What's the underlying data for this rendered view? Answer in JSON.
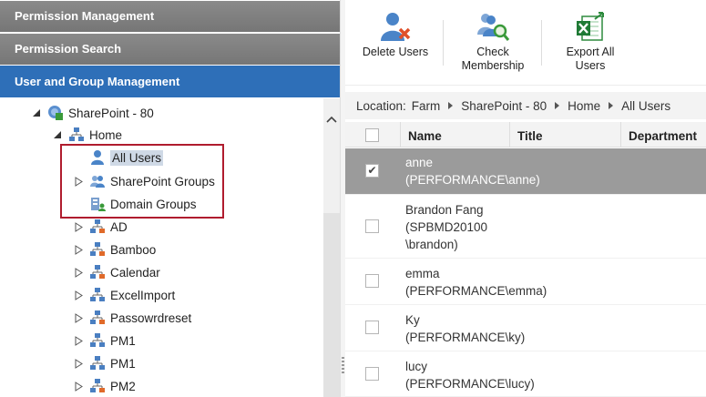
{
  "accordion": {
    "permission_management": "Permission Management",
    "permission_search": "Permission Search",
    "user_group_management": "User and Group Management"
  },
  "tree": {
    "root": "SharePoint - 80",
    "home": "Home",
    "all_users": "All Users",
    "sharepoint_groups": "SharePoint Groups",
    "domain_groups": "Domain Groups",
    "sites": [
      "AD",
      "Bamboo",
      "Calendar",
      "ExcelImport",
      "Passowrdreset",
      "PM1",
      "PM1",
      "PM2"
    ]
  },
  "ribbon": {
    "delete_users": "Delete Users",
    "check_membership_1": "Check",
    "check_membership_2": "Membership",
    "export_all_1": "Export All",
    "export_all_2": "Users"
  },
  "location": {
    "label": "Location:",
    "crumbs": [
      "Farm",
      "SharePoint - 80",
      "Home",
      "All Users"
    ]
  },
  "grid": {
    "columns": [
      "Name",
      "Title",
      "Department"
    ],
    "rows": [
      {
        "lines": [
          "anne",
          "(PERFORMANCE\\anne)"
        ],
        "checked": true
      },
      {
        "lines": [
          "Brandon Fang",
          "(SPBMD20100",
          "\\brandon)"
        ],
        "checked": false
      },
      {
        "lines": [
          "emma",
          "(PERFORMANCE\\emma)"
        ],
        "checked": false
      },
      {
        "lines": [
          "Ky",
          "(PERFORMANCE\\ky)"
        ],
        "checked": false
      },
      {
        "lines": [
          "lucy",
          "(PERFORMANCE\\lucy)"
        ],
        "checked": false
      }
    ]
  },
  "colors": {
    "accent": "#2e6fb8",
    "highlight_box": "#b01c2e",
    "selected_row": "#9b9b9b"
  }
}
